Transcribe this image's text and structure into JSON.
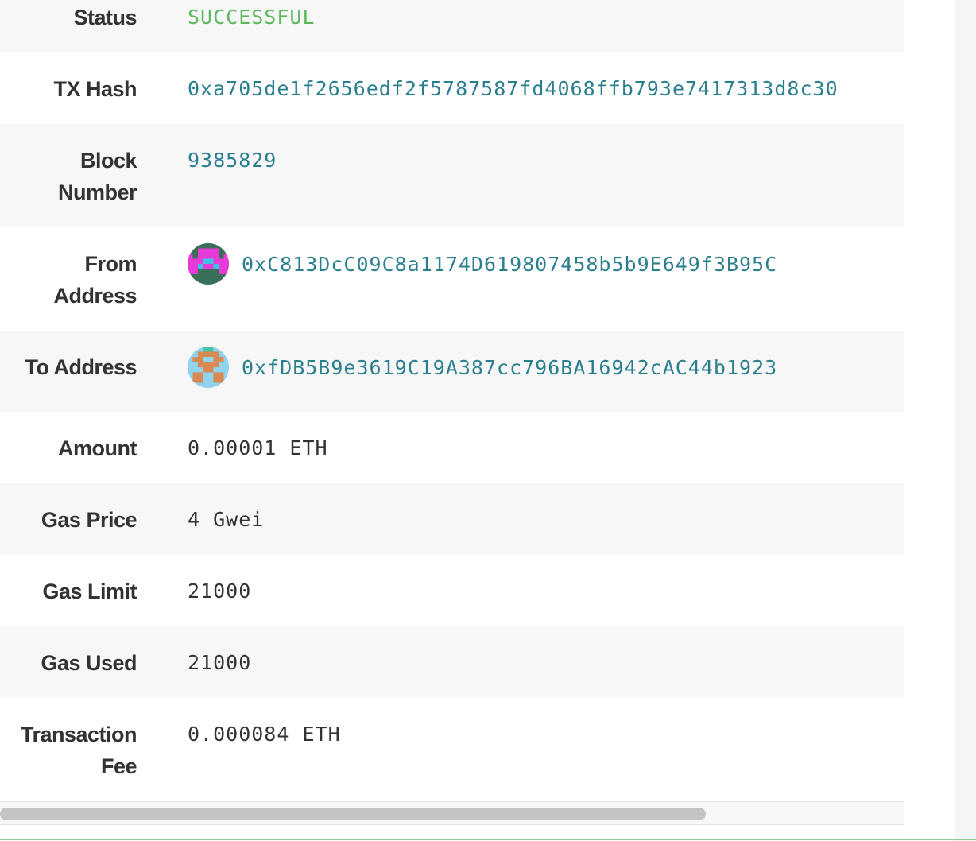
{
  "transaction": {
    "status": {
      "label": "Status",
      "value": "SUCCESSFUL"
    },
    "tx_hash": {
      "label": "TX Hash",
      "value": "0xa705de1f2656edf2f5787587fd4068ffb793e7417313d8c30"
    },
    "block_number": {
      "label_line1": "Block",
      "label_line2": "Number",
      "value": "9385829"
    },
    "from_address": {
      "label_line1": "From",
      "label_line2": "Address",
      "value": "0xC813DcC09C8a1174D619807458b5b9E649f3B95C",
      "avatar_icon": "identicon-avatar"
    },
    "to_address": {
      "label": "To Address",
      "value": "0xfDB5B9e3619C19A387cc796BA16942cAC44b1923",
      "avatar_icon": "identicon-avatar"
    },
    "amount": {
      "label": "Amount",
      "value": "0.00001 ETH"
    },
    "gas_price": {
      "label": "Gas Price",
      "value": "4 Gwei"
    },
    "gas_limit": {
      "label": "Gas Limit",
      "value": "21000"
    },
    "gas_used": {
      "label": "Gas Used",
      "value": "21000"
    },
    "transaction_fee": {
      "label_line1": "Transaction",
      "label_line2": "Fee",
      "value": "0.000084 ETH"
    }
  },
  "colors": {
    "success": "#5cb85c",
    "link": "#2a7f8f",
    "label": "#333333",
    "row_alt": "#f7f7f7"
  }
}
